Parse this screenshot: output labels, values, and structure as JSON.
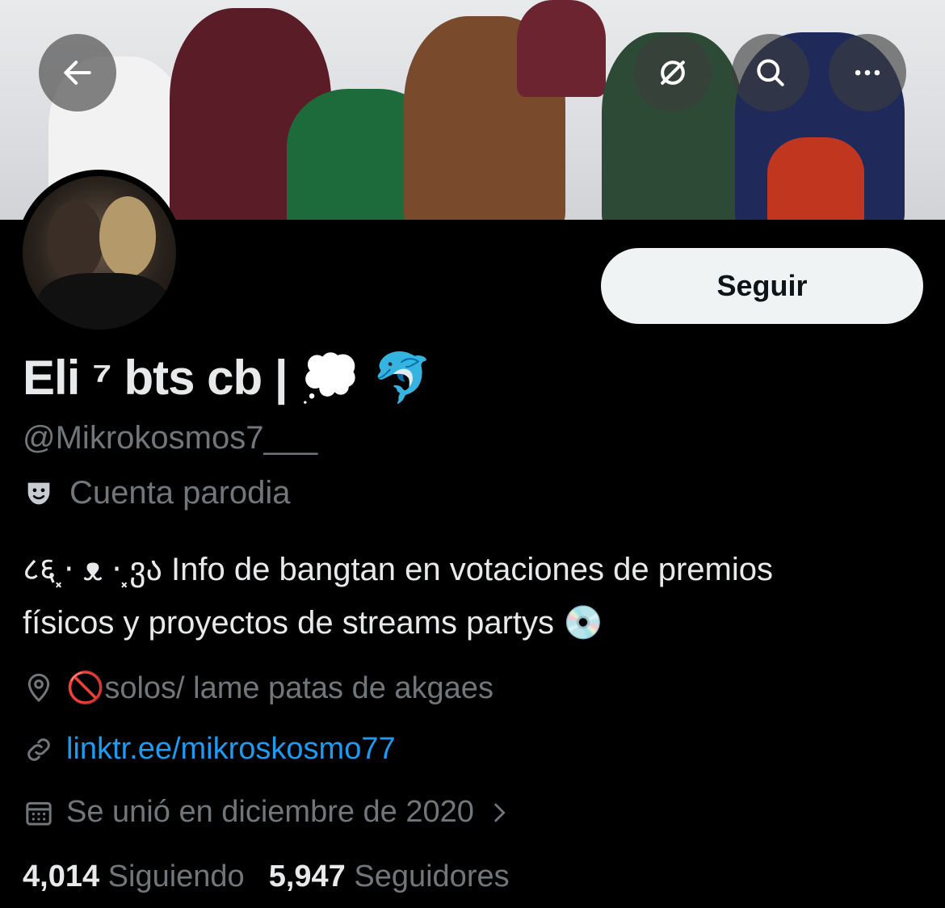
{
  "header": {
    "back_icon": "arrow-left-icon",
    "grok_icon": "slashed-circle-icon",
    "search_icon": "search-icon",
    "more_icon": "more-horizontal-icon"
  },
  "profile": {
    "follow_label": "Seguir",
    "display_name": "Eli ⁷ bts cb | 💭 🐬",
    "handle": "@Mikrokosmos7___",
    "parody_label": "Cuenta parodia",
    "bio_line1": "८६⸼⋅ ᴥ ⋅⸼ვა Info de bangtan en votaciones de premios",
    "bio_line2": "físicos y proyectos de streams partys 💿",
    "location": "🚫solos/ lame patas de akgaes",
    "website": "linktr.ee/mikroskosmo77",
    "joined": "Se unió en diciembre de 2020",
    "following_count": "4,014",
    "following_label": "Siguiendo",
    "followers_count": "5,947",
    "followers_label": "Seguidores"
  },
  "colors": {
    "background": "#000000",
    "text_primary": "#e7e9ea",
    "text_secondary": "#71767b",
    "link": "#1d9bf0",
    "follow_bg": "#eff3f4"
  }
}
